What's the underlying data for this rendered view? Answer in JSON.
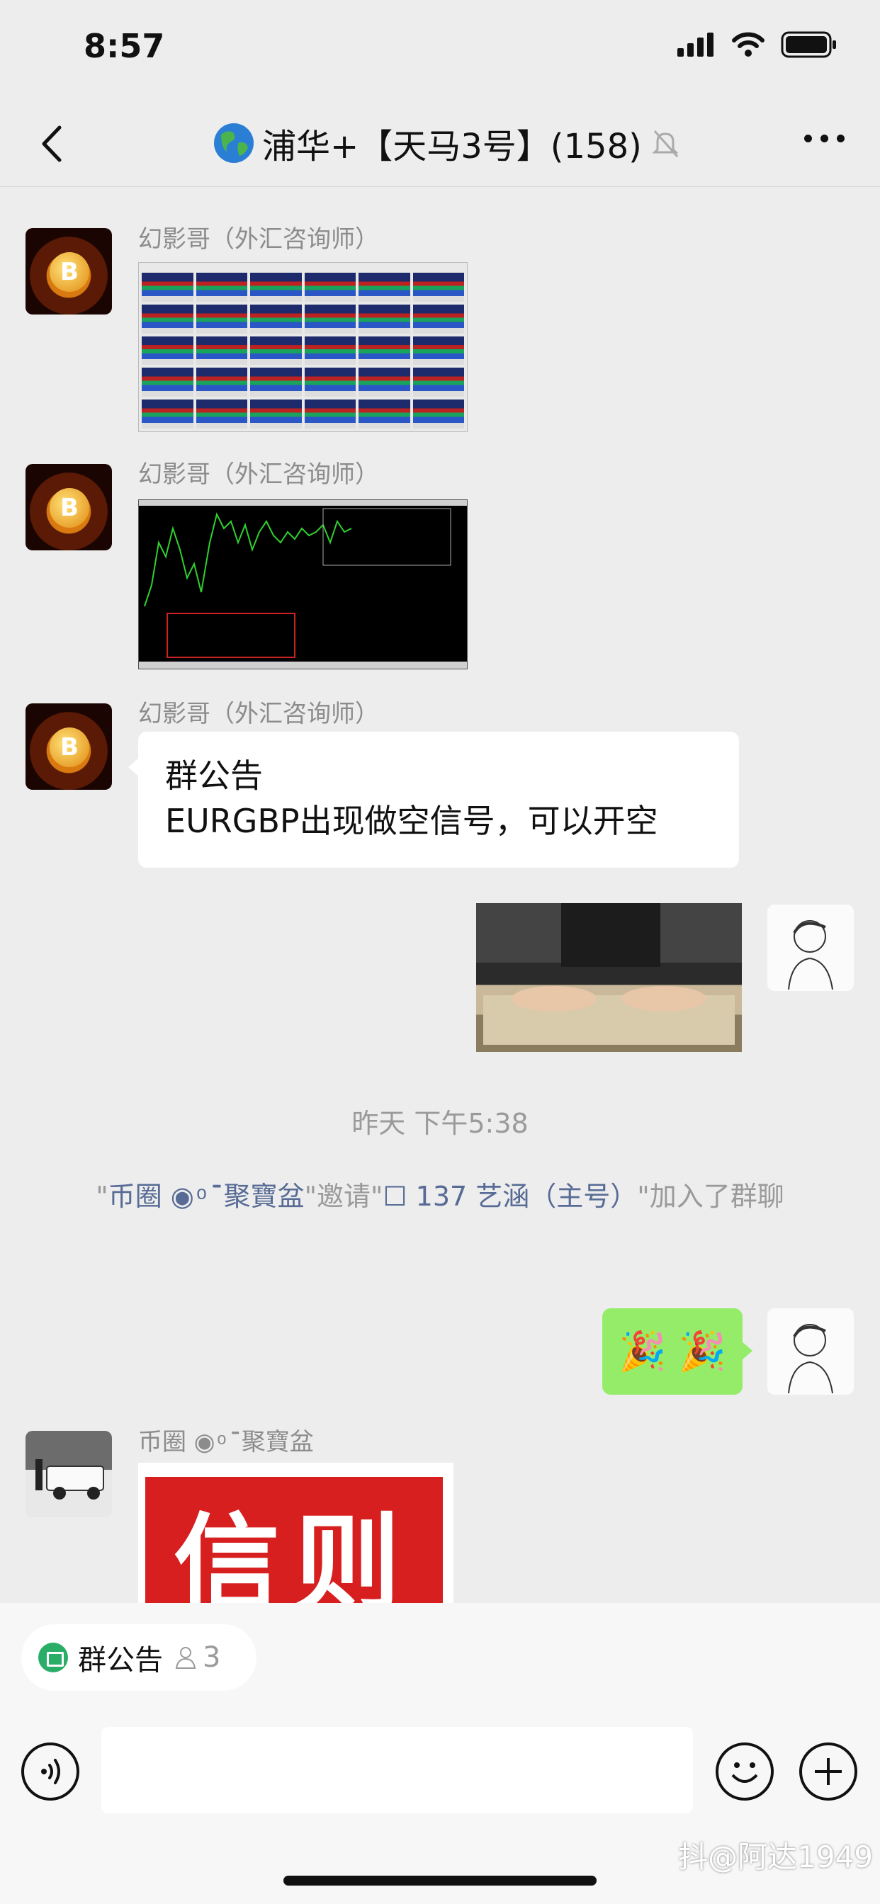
{
  "status": {
    "time": "8:57"
  },
  "nav": {
    "title": "浦华+【天马3号】(158)",
    "title_prefix_icon": "globe-icon",
    "mute_icon": "bell-off-icon"
  },
  "messages": {
    "m1": {
      "sender": "幻影哥（外汇咨询师）"
    },
    "m2": {
      "sender": "幻影哥（外汇咨询师）"
    },
    "m3": {
      "sender": "幻影哥（外汇咨询师）",
      "line1": "群公告",
      "line2": "EURGBP出现做空信号，可以开空"
    },
    "timestamp": "昨天 下午5:38",
    "system": {
      "q1": "\"",
      "inviter": "币圈 ◉ ͦ ˙̈聚寶盆",
      "q2": "\"邀请\"",
      "invitee": "☐ 137 艺涵（主号）",
      "q3": "\"加入了群聊"
    },
    "m5": {
      "emoji": "🎉 🎉"
    },
    "m6": {
      "sender": "币圈 ◉ ͦ ˙̈聚寶盆",
      "seal_text": "信则"
    }
  },
  "bottom": {
    "notice_label": "群公告",
    "notice_count": "3",
    "input_placeholder": "",
    "watermark": "抖@阿达1949"
  },
  "colors": {
    "bg": "#ededed",
    "link": "#576b95",
    "green_bubble": "#95ec69",
    "notice_icon": "#2aae67"
  }
}
